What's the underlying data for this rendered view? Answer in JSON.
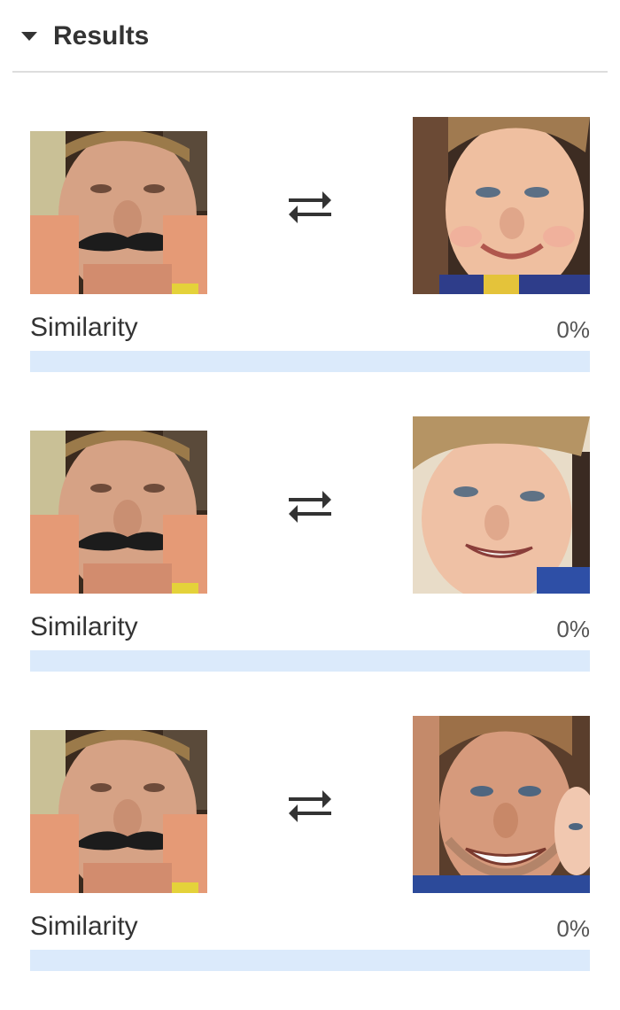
{
  "panel": {
    "title": "Results",
    "collapse_icon": "caret-down-icon"
  },
  "results": [
    {
      "source_face": "child-with-fake-mustache-face",
      "swap_icon": "swap-arrows-icon",
      "target_face": "smiling-boy-face",
      "label": "Similarity",
      "value_text": "0%",
      "similarity": 0
    },
    {
      "source_face": "child-with-fake-mustache-face",
      "swap_icon": "swap-arrows-icon",
      "target_face": "blond-boy-grinning-face",
      "label": "Similarity",
      "value_text": "0%",
      "similarity": 0
    },
    {
      "source_face": "child-with-fake-mustache-face",
      "swap_icon": "swap-arrows-icon",
      "target_face": "smiling-man-with-stubble-face",
      "label": "Similarity",
      "value_text": "0%",
      "similarity": 0
    }
  ],
  "colors": {
    "bar_track": "#dbeafb",
    "bar_fill": "#4a90e2",
    "divider": "#dddddd"
  }
}
